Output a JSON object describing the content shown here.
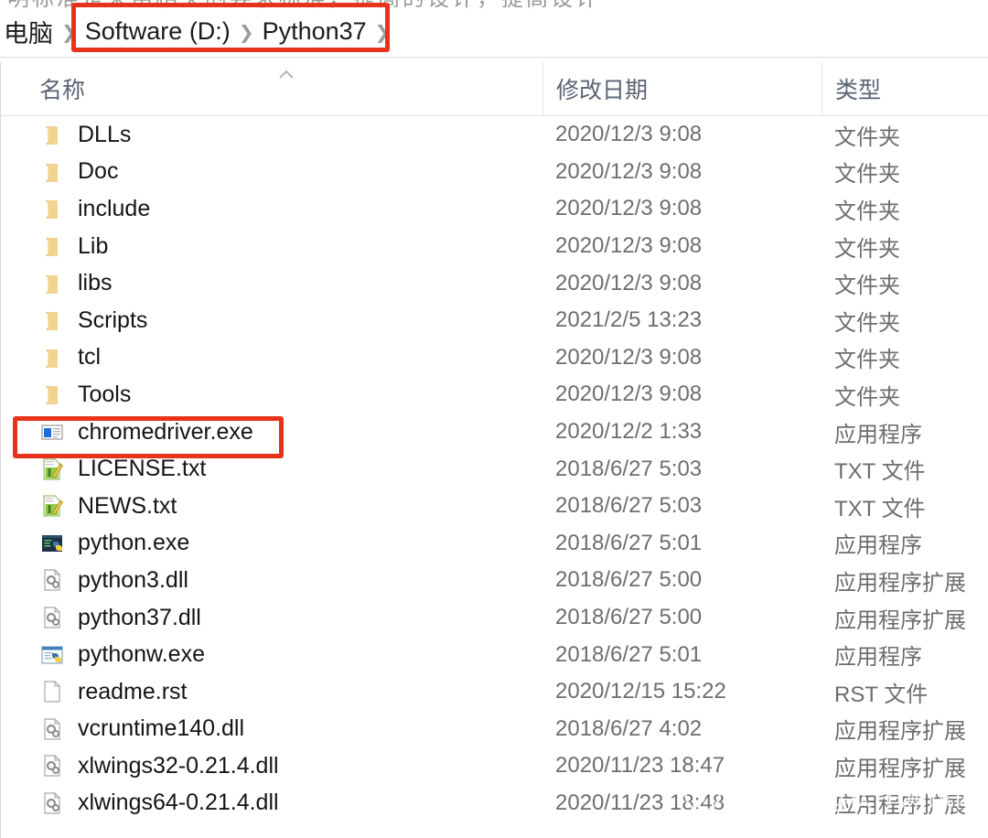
{
  "window": {
    "clipped_top_text": "明标准是采用相关的要求标准，提高的设计，提高设计"
  },
  "breadcrumb": {
    "separator": "❯",
    "items": [
      {
        "label": "电脑"
      },
      {
        "label": "Software (D:)"
      },
      {
        "label": "Python37"
      }
    ],
    "highlight_color": "#e8331c"
  },
  "columns": [
    {
      "key": "name",
      "label": "名称",
      "sort": "ascending"
    },
    {
      "key": "date",
      "label": "修改日期"
    },
    {
      "key": "type",
      "label": "类型"
    }
  ],
  "files": [
    {
      "name": "DLLs",
      "date": "2020/12/3 9:08",
      "type": "文件夹",
      "icon": "folder-icon",
      "highlighted": false
    },
    {
      "name": "Doc",
      "date": "2020/12/3 9:08",
      "type": "文件夹",
      "icon": "folder-icon",
      "highlighted": false
    },
    {
      "name": "include",
      "date": "2020/12/3 9:08",
      "type": "文件夹",
      "icon": "folder-icon",
      "highlighted": false
    },
    {
      "name": "Lib",
      "date": "2020/12/3 9:08",
      "type": "文件夹",
      "icon": "folder-icon",
      "highlighted": false
    },
    {
      "name": "libs",
      "date": "2020/12/3 9:08",
      "type": "文件夹",
      "icon": "folder-icon",
      "highlighted": false
    },
    {
      "name": "Scripts",
      "date": "2021/2/5 13:23",
      "type": "文件夹",
      "icon": "folder-icon",
      "highlighted": false
    },
    {
      "name": "tcl",
      "date": "2020/12/3 9:08",
      "type": "文件夹",
      "icon": "folder-icon",
      "highlighted": false
    },
    {
      "name": "Tools",
      "date": "2020/12/3 9:08",
      "type": "文件夹",
      "icon": "folder-icon",
      "highlighted": false
    },
    {
      "name": "chromedriver.exe",
      "date": "2020/12/2 1:33",
      "type": "应用程序",
      "icon": "console-app-icon",
      "highlighted": true
    },
    {
      "name": "LICENSE.txt",
      "date": "2018/6/27 5:03",
      "type": "TXT 文件",
      "icon": "text-file-icon",
      "highlighted": false
    },
    {
      "name": "NEWS.txt",
      "date": "2018/6/27 5:03",
      "type": "TXT 文件",
      "icon": "text-file-icon",
      "highlighted": false
    },
    {
      "name": "python.exe",
      "date": "2018/6/27 5:01",
      "type": "应用程序",
      "icon": "python-exe-icon",
      "highlighted": false
    },
    {
      "name": "python3.dll",
      "date": "2018/6/27 5:00",
      "type": "应用程序扩展",
      "icon": "dll-icon",
      "highlighted": false
    },
    {
      "name": "python37.dll",
      "date": "2018/6/27 5:00",
      "type": "应用程序扩展",
      "icon": "dll-icon",
      "highlighted": false
    },
    {
      "name": "pythonw.exe",
      "date": "2018/6/27 5:01",
      "type": "应用程序",
      "icon": "pythonw-exe-icon",
      "highlighted": false
    },
    {
      "name": "readme.rst",
      "date": "2020/12/15 15:22",
      "type": "RST 文件",
      "icon": "blank-file-icon",
      "highlighted": false
    },
    {
      "name": "vcruntime140.dll",
      "date": "2018/6/27 4:02",
      "type": "应用程序扩展",
      "icon": "dll-icon",
      "highlighted": false
    },
    {
      "name": "xlwings32-0.21.4.dll",
      "date": "2020/11/23 18:47",
      "type": "应用程序扩展",
      "icon": "dll-icon",
      "highlighted": false
    },
    {
      "name": "xlwings64-0.21.4.dll",
      "date": "2020/11/23 18:48",
      "type": "应用程序扩展",
      "icon": "dll-icon",
      "highlighted": false
    }
  ],
  "watermark": {
    "text": "51Testing软件测试网",
    "icon": "smiley-face-icon"
  }
}
